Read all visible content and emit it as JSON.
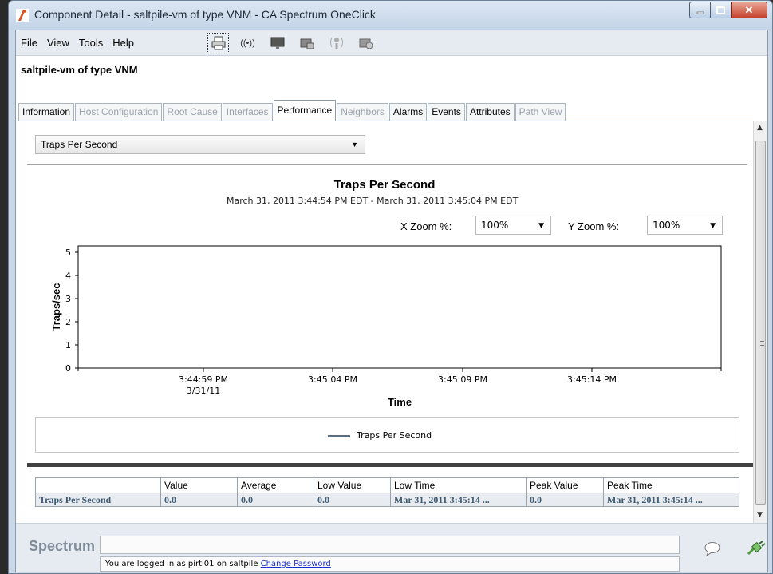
{
  "window": {
    "title": "Component Detail - saltpile-vm of type VNM - CA Spectrum OneClick"
  },
  "menu": {
    "items": [
      "File",
      "View",
      "Tools",
      "Help"
    ]
  },
  "toolbar": {
    "icons": [
      "print-icon",
      "signal-icon",
      "monitor-icon",
      "device-lock-icon",
      "info-signal-icon",
      "device-refresh-icon"
    ],
    "signal_text": "((•))"
  },
  "model_title": "saltpile-vm of type VNM",
  "tabs": [
    {
      "label": "Information",
      "state": "enabled"
    },
    {
      "label": "Host Configuration",
      "state": "disabled"
    },
    {
      "label": "Root Cause",
      "state": "disabled"
    },
    {
      "label": "Interfaces",
      "state": "disabled"
    },
    {
      "label": "Performance",
      "state": "selected"
    },
    {
      "label": "Neighbors",
      "state": "disabled"
    },
    {
      "label": "Alarms",
      "state": "enabled"
    },
    {
      "label": "Events",
      "state": "enabled"
    },
    {
      "label": "Attributes",
      "state": "enabled"
    },
    {
      "label": "Path View",
      "state": "disabled"
    }
  ],
  "metric_select": {
    "value": "Traps Per Second"
  },
  "chart": {
    "title": "Traps Per Second",
    "subtitle": "March 31, 2011 3:44:54 PM EDT   -   March 31, 2011 3:45:04 PM EDT",
    "x_zoom_label": "X Zoom %:",
    "x_zoom_value": "100%",
    "y_zoom_label": "Y Zoom %:",
    "y_zoom_value": "100%",
    "legend": "Traps Per Second"
  },
  "chart_data": {
    "type": "line",
    "title": "Traps Per Second",
    "xlabel": "Time",
    "ylabel": "Traps/sec",
    "ylim": [
      0,
      5
    ],
    "yticks": [
      0,
      1,
      2,
      3,
      4,
      5
    ],
    "xticks": [
      "3:44:59 PM",
      "3:45:04 PM",
      "3:45:09 PM",
      "3:45:14 PM"
    ],
    "xtick_date": "3/31/11",
    "series": [
      {
        "name": "Traps Per Second",
        "color": "#5a6e80",
        "values": []
      }
    ],
    "grid": false,
    "legend_position": "bottom"
  },
  "stats": {
    "headers": [
      "",
      "Value",
      "Average",
      "Low Value",
      "Low Time",
      "Peak Value",
      "Peak Time"
    ],
    "rows": [
      [
        "Traps Per Second",
        "0.0",
        "0.0",
        "0.0",
        "Mar 31, 2011 3:45:14 ...",
        "0.0",
        "Mar 31, 2011 3:45:14 ..."
      ]
    ]
  },
  "status": {
    "brand": "Spectrum",
    "login_text": "You are logged in as pirti01 on saltpile",
    "change_password": "Change Password"
  },
  "colors": {
    "accent": "#3d5a72",
    "series": "#5a6e80",
    "close": "#c6422b"
  }
}
